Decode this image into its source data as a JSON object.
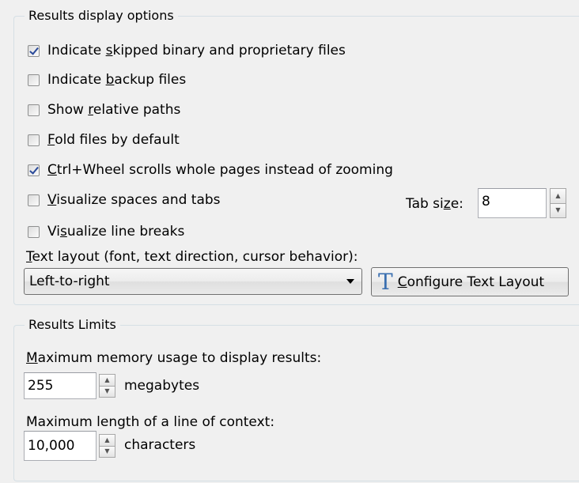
{
  "results_display": {
    "legend": "Results display options",
    "checkboxes": [
      {
        "pre": "Indicate ",
        "key": "s",
        "post": "kipped binary and proprietary files",
        "checked": true
      },
      {
        "pre": "Indicate ",
        "key": "b",
        "post": "ackup files",
        "checked": false
      },
      {
        "pre": "Show ",
        "key": "r",
        "post": "elative paths",
        "checked": false
      },
      {
        "pre": "",
        "key": "F",
        "post": "old files by default",
        "checked": false
      },
      {
        "pre": "",
        "key": "C",
        "post": "trl+Wheel scrolls whole pages instead of zooming",
        "checked": true
      },
      {
        "pre": "",
        "key": "V",
        "post": "isualize spaces and tabs",
        "checked": false
      },
      {
        "pre": "Vi",
        "key": "s",
        "post": "ualize line breaks",
        "checked": false
      }
    ],
    "tab_size": {
      "pre": "Tab si",
      "key": "z",
      "post": "e:",
      "value": "8"
    },
    "text_layout": {
      "label_key": "T",
      "label_post": "ext layout (font, text direction, cursor behavior):",
      "selected": "Left-to-right",
      "button_key": "C",
      "button_post": "onfigure Text Layout",
      "button_icon": "T"
    }
  },
  "results_limits": {
    "legend": "Results Limits",
    "memory_label_key": "M",
    "memory_label_post": "aximum memory usage to display results:",
    "memory_value": "255",
    "memory_unit": "megabytes",
    "context_label": "Maximum length of a line of context:",
    "context_value": "10,000",
    "context_unit": "characters"
  },
  "icons": {
    "spin_up": "▲",
    "spin_down": "▼",
    "check": "checkmark-icon",
    "dropdown": "dropdown-arrow-icon",
    "text_layout": "text-layout-icon"
  }
}
